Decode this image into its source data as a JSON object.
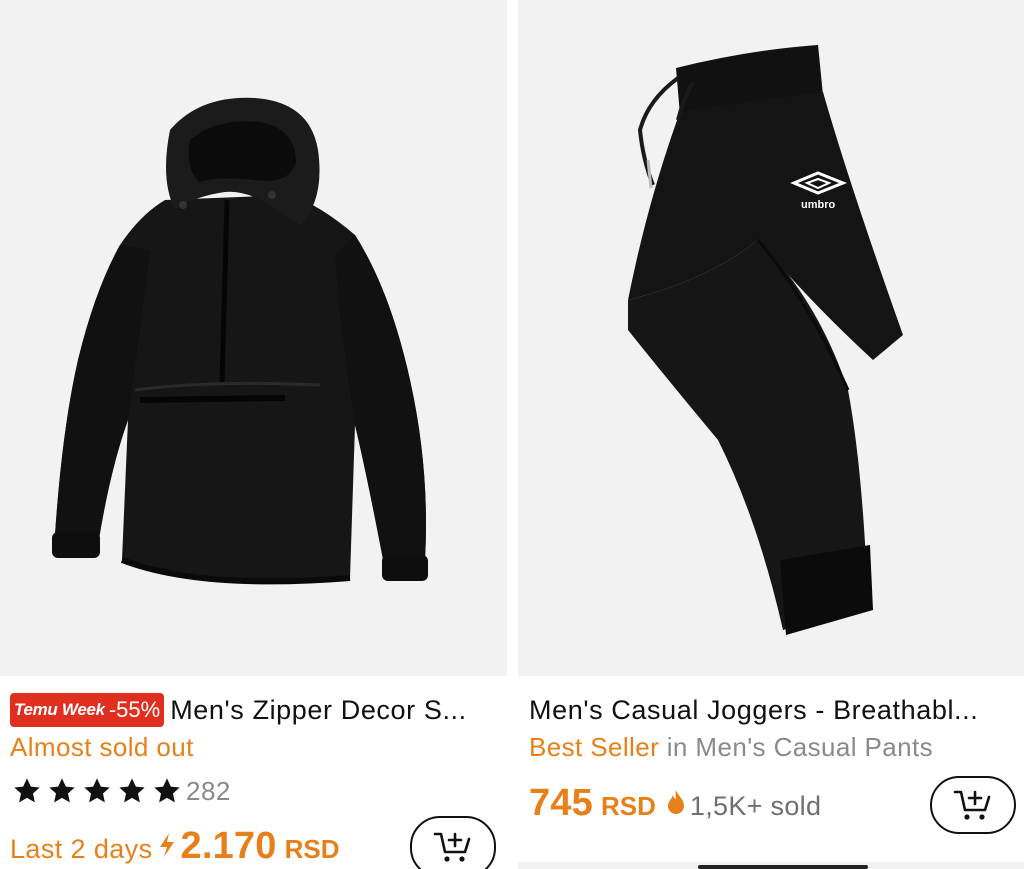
{
  "products": [
    {
      "badge": {
        "label": "Temu Week",
        "discount": "-55%"
      },
      "title": "Men's Zipper Decor S...",
      "stock_text": "Almost sold out",
      "rating": {
        "stars": 5,
        "count": "282"
      },
      "price": {
        "label": "Last 2 days",
        "amount": "2.170",
        "currency": "RSD"
      },
      "image": "black half-zip hooded windbreaker jacket"
    },
    {
      "title": "Men's Casual Joggers - Breathabl...",
      "bestseller": {
        "label": "Best Seller",
        "category": "in Men's Casual Pants"
      },
      "price": {
        "amount": "745",
        "currency": "RSD"
      },
      "sold": "1,5K+ sold",
      "image": "black umbro jogger pants",
      "brand_logo_text": "umbro"
    }
  ],
  "icons": {
    "cart": "add-to-cart-icon",
    "star": "star-icon",
    "bolt": "lightning-icon",
    "flame": "flame-icon"
  },
  "colors": {
    "accent_orange": "#e8801a",
    "badge_red": "#e02f1f",
    "image_bg": "#f2f2f2",
    "text_grey": "#8a8a8a"
  }
}
